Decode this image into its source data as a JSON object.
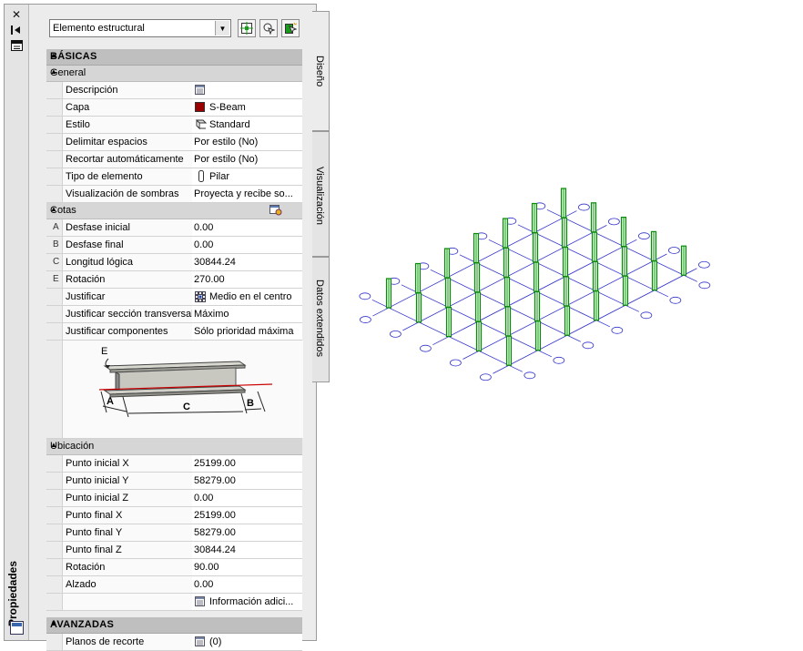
{
  "palette": {
    "title": "Propiedades",
    "object_selector": "Elemento estructural",
    "tabs": [
      "Diseño",
      "Visualización",
      "Datos extendidos"
    ]
  },
  "sections": {
    "basicas": "BÁSICAS",
    "general": "General",
    "cotas": "Cotas",
    "ubicacion": "Ubicación",
    "avanzadas": "AVANZADAS"
  },
  "general_rows": [
    {
      "name": "Descripción",
      "value": ""
    },
    {
      "name": "Capa",
      "value": "S-Beam"
    },
    {
      "name": "Estilo",
      "value": "Standard"
    },
    {
      "name": "Delimitar espacios",
      "value": "Por estilo (No)"
    },
    {
      "name": "Recortar automáticamente",
      "value": "Por estilo (No)"
    },
    {
      "name": "Tipo de elemento",
      "value": "Pilar"
    },
    {
      "name": "Visualización de sombras",
      "value": "Proyecta y recibe so..."
    }
  ],
  "cotas_rows": [
    {
      "key": "A",
      "name": "Desfase inicial",
      "value": "0.00"
    },
    {
      "key": "B",
      "name": "Desfase final",
      "value": "0.00"
    },
    {
      "key": "C",
      "name": "Longitud lógica",
      "value": "30844.24"
    },
    {
      "key": "E",
      "name": "Rotación",
      "value": "270.00"
    },
    {
      "key": "",
      "name": "Justificar",
      "value": "Medio en el centro"
    },
    {
      "key": "",
      "name": "Justificar sección transversal",
      "value": "Máximo"
    },
    {
      "key": "",
      "name": "Justificar componentes",
      "value": "Sólo prioridad máxima"
    }
  ],
  "diagram_labels": {
    "e": "E",
    "a": "A",
    "c": "C",
    "b": "B"
  },
  "ubicacion_rows": [
    {
      "name": "Punto inicial X",
      "value": "25199.00"
    },
    {
      "name": "Punto inicial Y",
      "value": "58279.00"
    },
    {
      "name": "Punto inicial Z",
      "value": "0.00"
    },
    {
      "name": "Punto final X",
      "value": "25199.00"
    },
    {
      "name": "Punto final Y",
      "value": "58279.00"
    },
    {
      "name": "Punto final Z",
      "value": "30844.24"
    },
    {
      "name": "Rotación",
      "value": "90.00"
    },
    {
      "name": "Alzado",
      "value": "0.00"
    },
    {
      "name": "",
      "value": "Información adici..."
    }
  ],
  "avanzadas_rows": [
    {
      "name": "Planos de recorte",
      "value": "(0)"
    }
  ],
  "colors": {
    "layer_swatch": "#9b0000",
    "column": "#0a8a0a",
    "grid_line": "#3333cc"
  }
}
